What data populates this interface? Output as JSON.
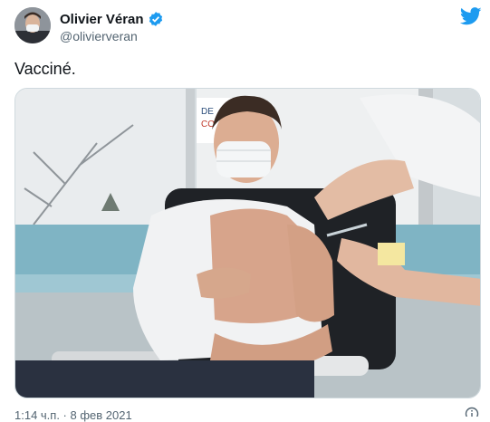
{
  "header": {
    "display_name": "Olivier Véran",
    "handle": "@olivierveran",
    "verified_icon": "verified-badge-icon",
    "logo_icon": "twitter-bird-icon",
    "brand_color": "#1d9bf0"
  },
  "tweet": {
    "text": "Vacciné.",
    "media_description_icon": "photo"
  },
  "media": {
    "sign_text_1": "DE",
    "sign_text_2": "CO"
  },
  "footer": {
    "timestamp": "1:14 ч.п. · 8 фев 2021",
    "info_icon": "info-icon"
  }
}
